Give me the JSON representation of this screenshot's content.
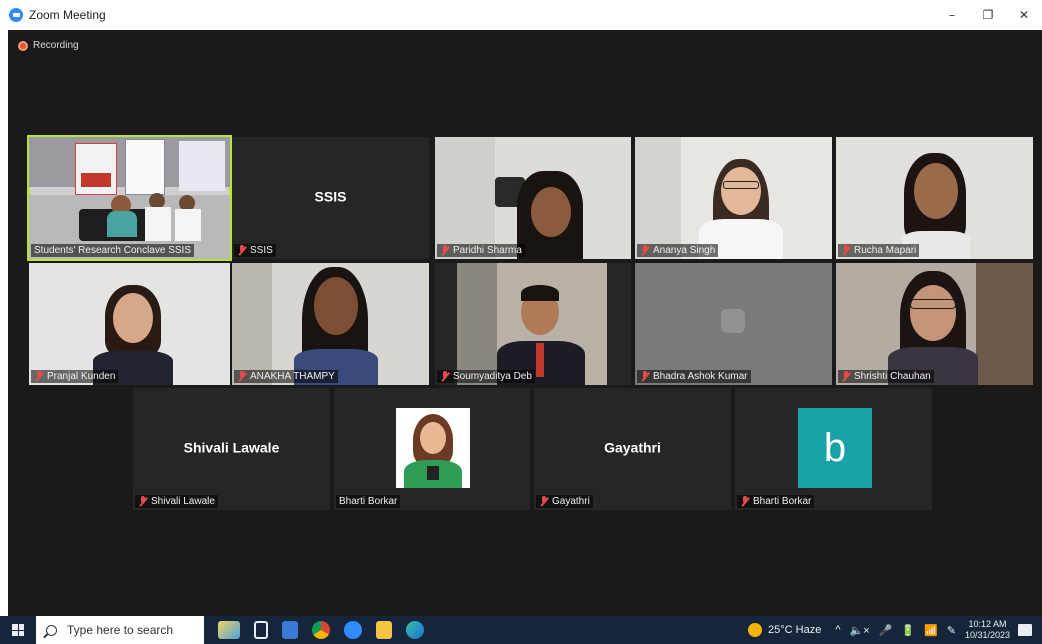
{
  "window": {
    "title": "Zoom Meeting",
    "controls": [
      "–",
      "❐",
      "✕"
    ]
  },
  "meeting": {
    "recording_label": "Recording"
  },
  "tiles": {
    "t1": {
      "name": "Students' Research Conclave SSIS",
      "muted": false
    },
    "t2": {
      "name": "SSIS",
      "center": "SSIS",
      "muted": true
    },
    "t3": {
      "name": "Paridhi Sharma",
      "muted": true
    },
    "t4": {
      "name": "Ananya Singh",
      "muted": true
    },
    "t5": {
      "name": "Rucha Mapari",
      "muted": true
    },
    "t6": {
      "name": "Pranjal Kunden",
      "muted": true
    },
    "t7": {
      "name": "ANAKHA THAMPY",
      "muted": true
    },
    "t8": {
      "name": "Soumyaditya Deb",
      "muted": true
    },
    "t9": {
      "name": "Bhadra Ashok Kumar",
      "muted": true
    },
    "t10": {
      "name": "Shrishti Chauhan",
      "muted": true
    },
    "t11": {
      "name": "Shivali Lawale",
      "center": "Shivali Lawale",
      "muted": true
    },
    "t12": {
      "name": "Bharti Borkar",
      "muted": false
    },
    "t13": {
      "name": "Gayathri",
      "center": "Gayathri",
      "muted": true
    },
    "t14": {
      "name": "Bharti Borkar",
      "avatar_letter": "b",
      "muted": true
    }
  },
  "colors": {
    "active_speaker": "#b6e23a",
    "muted": "#e84a4a",
    "avatar_bg": "#1aa3a6",
    "taskbar": "#16263a"
  },
  "taskbar": {
    "search_placeholder": "Type here to search",
    "temperature": "25°C",
    "weather": "Haze",
    "time": "10:12 AM",
    "date": "10/31/2023",
    "tray_glyphs": [
      "^",
      "🔈×",
      "🎤",
      "🔋",
      "📶",
      "✎"
    ]
  }
}
